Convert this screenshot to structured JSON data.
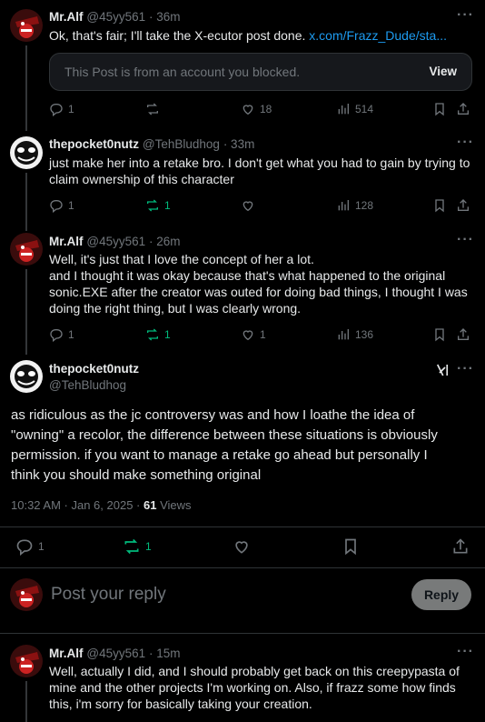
{
  "tweets": [
    {
      "name": "Mr.Alf",
      "handle": "@45yy561",
      "time": "· 36m",
      "text": "Ok, that's fair; I'll take the X-ecutor post done.",
      "link": "x.com/Frazz_Dude/sta...",
      "quote_text": "This Post is from an account you blocked.",
      "quote_button": "View",
      "replies": "1",
      "reposts": "",
      "likes": "18",
      "views": "514"
    },
    {
      "name": "thepocket0nutz",
      "handle": "@TehBludhog",
      "time": "· 33m",
      "text_lines": [
        "just make her into a retake bro. I don't get what you had to gain by trying to",
        "claim ownership of this character"
      ],
      "replies": "1",
      "reposts": "1",
      "likes": "",
      "views": "128"
    },
    {
      "name": "Mr.Alf",
      "handle": "@45yy561",
      "time": "· 26m",
      "text_lines": [
        "Well, it's just that I love the concept of her a lot.",
        "and I thought it was okay because that's what happened to the original",
        "sonic.EXE after the creator was outed for doing bad things, I thought I was",
        "doing the right thing, but I was clearly wrong."
      ],
      "replies": "1",
      "reposts": "1",
      "likes": "1",
      "views": "136"
    }
  ],
  "main_post": {
    "name": "thepocket0nutz",
    "handle": "@TehBludhog",
    "text_lines": [
      "as ridiculous as the jc controversy was and how I loathe the idea of",
      "\"owning\" a recolor, the difference between these situations is obviously",
      "permission. if you want to manage a retake go ahead but personally I",
      "think you should make something original"
    ],
    "timestamp": "10:32 AM · Jan 6, 2025 · ",
    "views_count": "61",
    "views_label": " Views",
    "replies": "1",
    "reposts": "1"
  },
  "reply_box": {
    "placeholder": "Post your reply",
    "button": "Reply"
  },
  "bottom_tweet": {
    "name": "Mr.Alf",
    "handle": "@45yy561",
    "time": "· 15m",
    "text_lines": [
      "Well, actually I did, and I should probably get back on this creepypasta of",
      "mine and the other projects I'm working on. Also, if frazz some how finds",
      "this, i'm sorry for basically taking your creation."
    ]
  },
  "icons": {
    "more": "···",
    "grok": "grok-icon"
  }
}
